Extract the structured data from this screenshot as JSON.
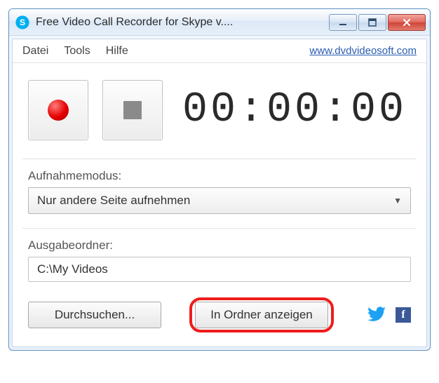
{
  "titlebar": {
    "title": "Free Video Call Recorder for Skype v...."
  },
  "menubar": {
    "file": "Datei",
    "tools": "Tools",
    "help": "Hilfe",
    "website_link": "www.dvdvideosoft.com"
  },
  "timer": {
    "display": "00:00:00"
  },
  "mode": {
    "label": "Aufnahmemodus:",
    "selected": "Nur andere Seite aufnehmen"
  },
  "output": {
    "label": "Ausgabeordner:",
    "path": "C:\\My Videos"
  },
  "buttons": {
    "browse": "Durchsuchen...",
    "show_in_folder": "In Ordner anzeigen"
  },
  "social": {
    "facebook_glyph": "f"
  }
}
